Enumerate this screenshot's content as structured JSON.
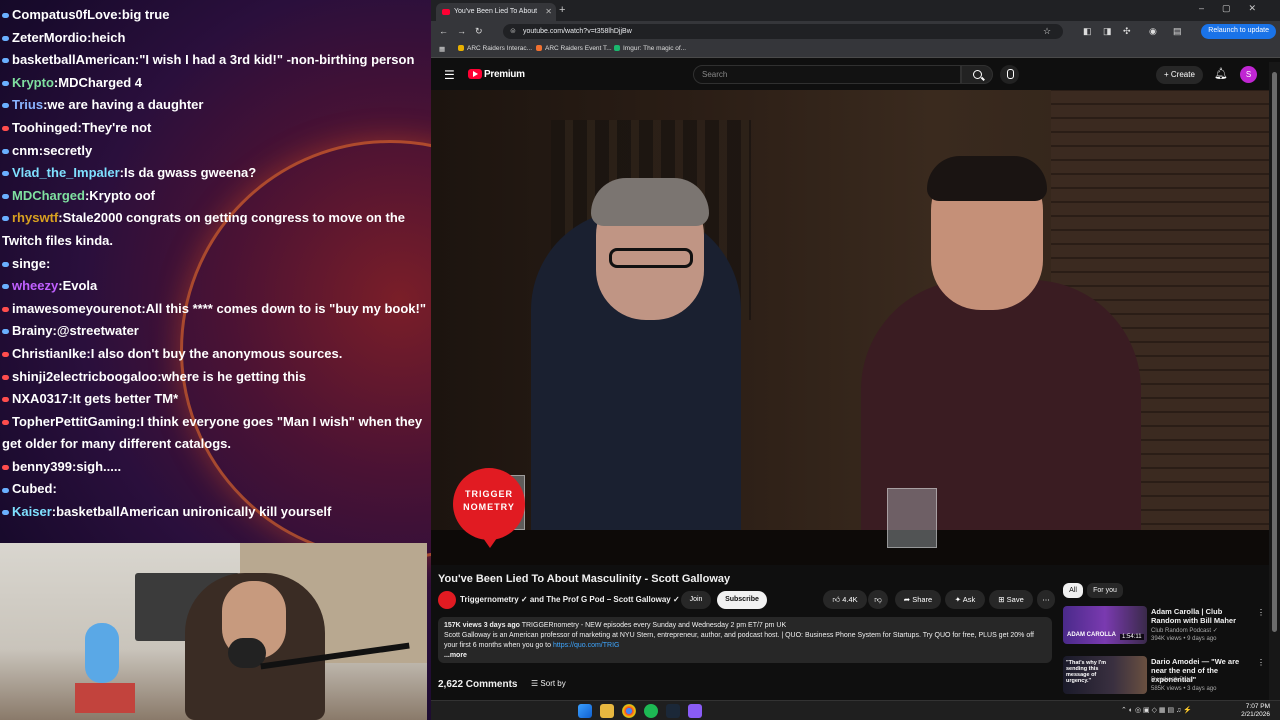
{
  "chat": {
    "messages": [
      {
        "user": "Compatus0fLove",
        "text": "big true",
        "color": "#ffffff",
        "badge": "#6ab0ff"
      },
      {
        "user": "ZeterMordio",
        "text": "heich",
        "color": "#ffffff",
        "badge": "#6ab0ff"
      },
      {
        "user": "basketballAmerican",
        "text": "\"I wish I had a 3rd kid!\" -non-birthing person",
        "color": "#ffffff",
        "badge": "#6ab0ff"
      },
      {
        "user": "Krypto",
        "text": "MDCharged 4",
        "color": "#7fe0a0",
        "badge": "#6ab0ff"
      },
      {
        "user": "Trius",
        "text": "we are having a daughter",
        "color": "#8ab4ff",
        "badge": "#6ab0ff"
      },
      {
        "user": "Toohinged",
        "text": "They're not",
        "color": "#ffffff",
        "badge": "#ff4d4d"
      },
      {
        "user": "cnm",
        "text": "secretly",
        "color": "#ffffff",
        "badge": "#6ab0ff"
      },
      {
        "user": "Vlad_the_Impaler",
        "text": "Is da gwass gweena?",
        "color": "#7fe0ff",
        "badge": "#6ab0ff"
      },
      {
        "user": "MDCharged",
        "text": "Krypto oof",
        "color": "#7fe0a0",
        "badge": "#6ab0ff"
      },
      {
        "user": "rhyswtf",
        "text": "Stale2000 congrats on getting congress to move on the Twitch files kinda.",
        "color": "#d8a020",
        "badge": "#6ab0ff"
      },
      {
        "user": "singe",
        "text": "",
        "color": "#ffffff",
        "badge": "#6ab0ff"
      },
      {
        "user": "wheezy",
        "text": "Evola",
        "color": "#c060ff",
        "badge": "#6ab0ff"
      },
      {
        "user": "imawesomeyourenot",
        "text": "All this **** comes down to is \"buy my book!\"",
        "color": "#ffffff",
        "badge": "#ff4d4d"
      },
      {
        "user": "Brainy",
        "text": "@streetwater",
        "color": "#ffffff",
        "badge": "#6ab0ff"
      },
      {
        "user": "ChristianIke",
        "text": "I also don't buy the anonymous sources.",
        "color": "#ffffff",
        "badge": "#ff4d4d"
      },
      {
        "user": "shinji2electricboogaloo",
        "text": "where is he getting this",
        "color": "#ffffff",
        "badge": "#ff4d4d"
      },
      {
        "user": "NXA0317",
        "text": "It gets better TM*",
        "color": "#ffffff",
        "badge": "#ff4d4d"
      },
      {
        "user": "TopherPettitGaming",
        "text": "I think everyone goes \"Man I wish\" when they get older for many different catalogs.",
        "color": "#ffffff",
        "badge": "#ff4d4d"
      },
      {
        "user": "benny399",
        "text": "sigh.....",
        "color": "#ffffff",
        "badge": "#ff4d4d"
      },
      {
        "user": "Cubed",
        "text": "",
        "color": "#ffffff",
        "badge": "#6ab0ff"
      },
      {
        "user": "Kaiser",
        "text": "basketballAmerican unironically kill yourself",
        "color": "#7fe0ff",
        "badge": "#6ab0ff"
      }
    ]
  },
  "browser": {
    "tab_title": "You've Been Lied To About",
    "url": "youtube.com/watch?v=t358lhDjjBw",
    "relaunch_label": "Relaunch to update",
    "bookmarks": [
      "ARC Raiders Interac...",
      "ARC Raiders Event T...",
      "Imgur: The magic of..."
    ]
  },
  "youtube": {
    "brand": "Premium",
    "search_placeholder": "Search",
    "create_label": "Create",
    "avatar_letter": "S",
    "video_title": "You've Been Lied To About Masculinity - Scott Galloway",
    "watermark": "TRIGGER NOMETRY",
    "channel": "Triggernometry ✓ and The Prof G Pod – Scott Galloway ✓",
    "join_label": "Join",
    "subscribe_label": "Subscribe",
    "actions": {
      "likes": "4.4K",
      "share": "Share",
      "ask": "Ask",
      "save": "Save"
    },
    "description": {
      "meta": "157K views  3 days ago",
      "line1": "TRIGGERnometry - NEW episodes every Sunday and Wednesday 2 pm ET/7 pm UK",
      "line2": "Scott Galloway is an American professor of marketing at NYU Stern, entrepreneur, author, and podcast host. | QUO: Business Phone System for Startups. Try QUO for free, PLUS get 20% off your first 6 months when you go to ",
      "link": "https://quo.com/TRIG",
      "more": "...more"
    },
    "comments_count": "2,622 Comments",
    "sort_label": "Sort by",
    "chips": [
      "All",
      "For you"
    ],
    "recommendations": [
      {
        "title": "Adam Carolla | Club Random with Bill Maher",
        "channel": "Club Random Podcast ✓",
        "views": "394K views • 9 days ago",
        "duration": "1:54:11",
        "thumb_label": "ADAM CAROLLA"
      },
      {
        "title": "Dario Amodei — \"We are near the end of the exponential\"",
        "channel": "Dwarkesh Patel",
        "views": "585K views • 3 days ago",
        "duration": "",
        "thumb_label": "\"That's why I'm sending this message of urgency.\""
      }
    ]
  },
  "taskbar": {
    "time": "7:07 PM",
    "date": "2/21/2026"
  }
}
